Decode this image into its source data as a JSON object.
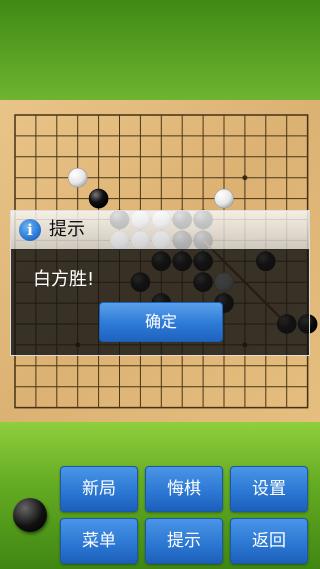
{
  "board": {
    "size": 15,
    "stones": [
      {
        "color": "white",
        "col": 3,
        "row": 3
      },
      {
        "color": "black",
        "col": 4,
        "row": 4
      },
      {
        "color": "white",
        "col": 10,
        "row": 4
      },
      {
        "color": "black",
        "col": 5,
        "row": 5
      },
      {
        "color": "white",
        "col": 6,
        "row": 5
      },
      {
        "color": "white",
        "col": 7,
        "row": 5
      },
      {
        "color": "black",
        "col": 8,
        "row": 5
      },
      {
        "color": "black",
        "col": 9,
        "row": 5
      },
      {
        "color": "white",
        "col": 5,
        "row": 6
      },
      {
        "color": "white",
        "col": 6,
        "row": 6
      },
      {
        "color": "white",
        "col": 7,
        "row": 6
      },
      {
        "color": "black",
        "col": 8,
        "row": 6
      },
      {
        "color": "black",
        "col": 9,
        "row": 6
      },
      {
        "color": "black",
        "col": 7,
        "row": 7
      },
      {
        "color": "black",
        "col": 8,
        "row": 7
      },
      {
        "color": "black",
        "col": 9,
        "row": 7
      },
      {
        "color": "black",
        "col": 12,
        "row": 7
      },
      {
        "color": "black",
        "col": 6,
        "row": 8
      },
      {
        "color": "black",
        "col": 9,
        "row": 8
      },
      {
        "color": "white",
        "col": 10,
        "row": 8
      },
      {
        "color": "black",
        "col": 7,
        "row": 9
      },
      {
        "color": "black",
        "col": 10,
        "row": 9
      },
      {
        "color": "black",
        "col": 13,
        "row": 10
      },
      {
        "color": "black",
        "col": 14,
        "row": 10
      }
    ],
    "win_line": {
      "from": {
        "col": 9,
        "row": 6
      },
      "to": {
        "col": 13,
        "row": 10
      }
    }
  },
  "dialog": {
    "icon": "info-icon",
    "icon_glyph": "i",
    "title": "提示",
    "message": "白方胜!",
    "ok_label": "确定"
  },
  "current_player_stone": "black",
  "buttons": {
    "new_game": "新局",
    "undo": "悔棋",
    "settings": "设置",
    "menu": "菜单",
    "hint": "提示",
    "back": "返回"
  },
  "colors": {
    "board": "#dcb273",
    "button": "#2a76d2",
    "dialog_body": "#141414"
  }
}
